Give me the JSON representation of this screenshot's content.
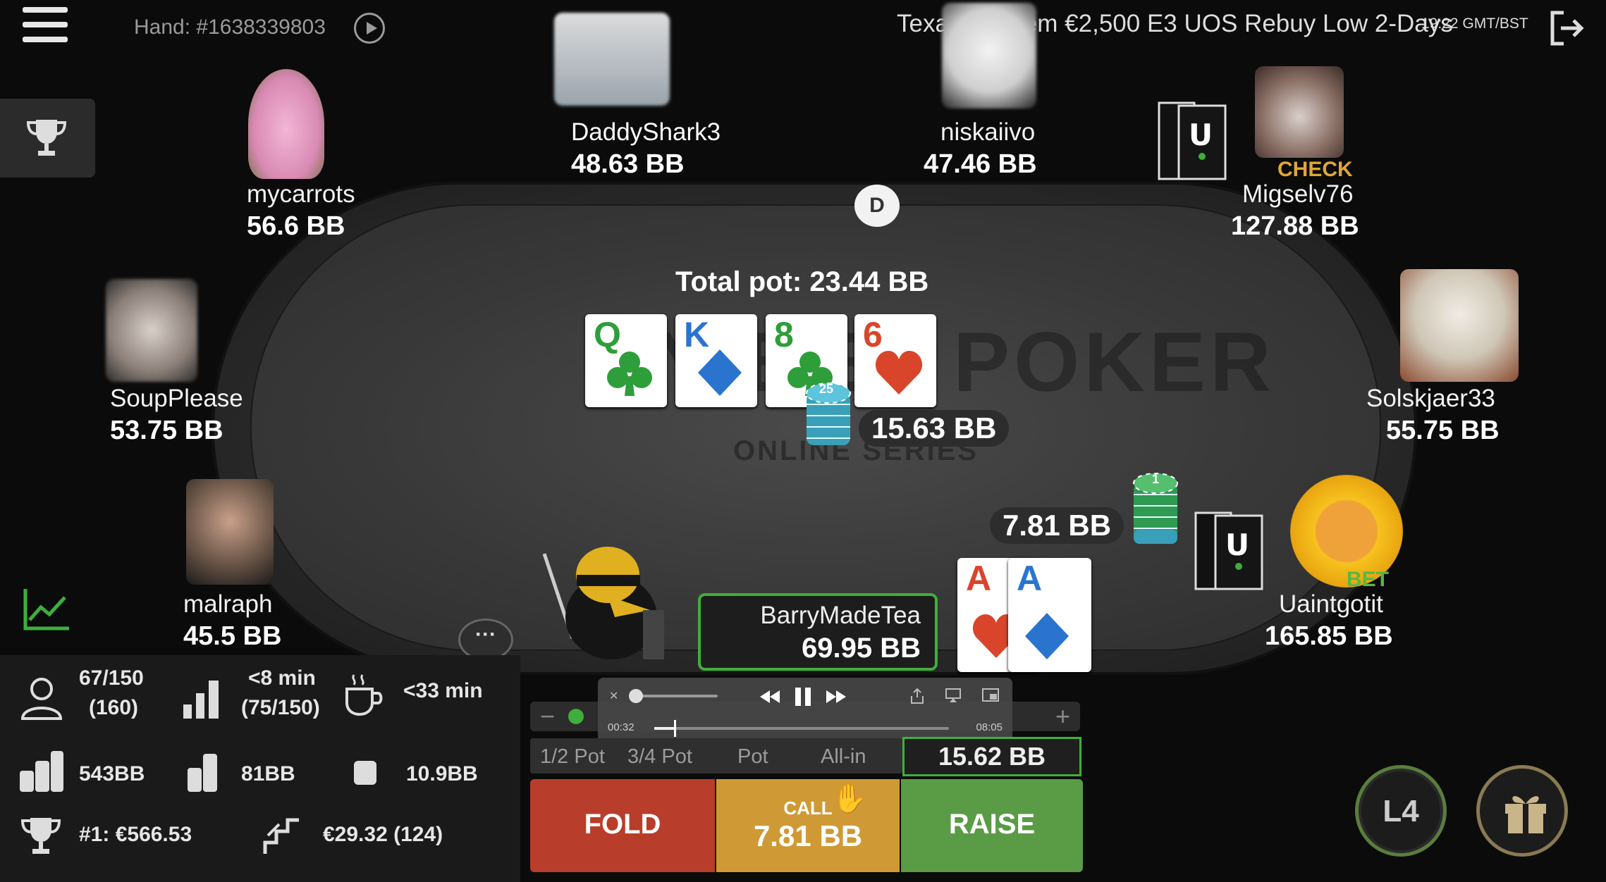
{
  "header": {
    "hand_id": "Hand: #1638339803",
    "game_title": "Texas Hold'em  €2,500 E3 UOS Rebuy Low 2-Days",
    "time": "19:22 GMT/BST"
  },
  "table": {
    "total_pot": "Total pot: 23.44 BB",
    "dealer_button": "D",
    "watermark": "UNIBET POKER",
    "watermark_sub": "ONLINE SERIES",
    "board": [
      {
        "rank": "Q",
        "suit": "clubs",
        "color": "#2e9e3a"
      },
      {
        "rank": "K",
        "suit": "diamonds",
        "color": "#2a74d0"
      },
      {
        "rank": "8",
        "suit": "clubs",
        "color": "#2e9e3a"
      },
      {
        "rank": "6",
        "suit": "hearts",
        "color": "#d9452b"
      }
    ],
    "center_bet": "15.63 BB",
    "center_chip_label": "25",
    "uaintgotit_bet": "7.81 BB",
    "uaintgotit_chip_label": "1"
  },
  "players": {
    "daddyshark": {
      "name": "DaddyShark3",
      "stack": "48.63 BB"
    },
    "niskaiivo": {
      "name": "niskaiivo",
      "stack": "47.46 BB"
    },
    "migselv": {
      "name": "Migselv76",
      "stack": "127.88 BB",
      "status": "CHECK"
    },
    "mycarrots": {
      "name": "mycarrots",
      "stack": "56.6 BB"
    },
    "soupplease": {
      "name": "SoupPlease",
      "stack": "53.75 BB"
    },
    "solskjaer": {
      "name": "Solskjaer33",
      "stack": "55.75 BB"
    },
    "malraph": {
      "name": "malraph",
      "stack": "45.5 BB"
    },
    "uaintgotit": {
      "name": "Uaintgotit",
      "stack": "165.85 BB",
      "status": "BET"
    },
    "hero": {
      "name": "BarryMadeTea",
      "stack": "69.95 BB",
      "cards": [
        {
          "rank": "A",
          "suit": "hearts",
          "color": "#d9452b"
        },
        {
          "rank": "A",
          "suit": "diamonds",
          "color": "#2a74d0"
        }
      ]
    }
  },
  "stats": {
    "players": "67/150",
    "players_sub": "(160)",
    "level_time": "<8 min",
    "level_sub": "(75/150)",
    "break_time": "<33 min",
    "avg_stack": "543BB",
    "min_stack": "81BB",
    "small_stack": "10.9BB",
    "first_prize": "#1: €566.53",
    "next_payout": "€29.32 (124)"
  },
  "video": {
    "current": "00:32",
    "duration": "08:05",
    "progress": 0.066
  },
  "actions": {
    "presets": [
      "1/2 Pot",
      "3/4 Pot",
      "Pot",
      "All-in"
    ],
    "raise_amount": "15.62 BB",
    "fold": "FOLD",
    "call_label": "CALL",
    "call_amount": "7.81 BB",
    "raise": "RAISE",
    "level_badge": "L4"
  },
  "colors": {
    "accent_green": "#3fae3c",
    "fold": "#b83d2a",
    "call": "#cf9a35",
    "raise": "#5a9b46",
    "check": "#e0a63a",
    "bet": "#57b847"
  }
}
